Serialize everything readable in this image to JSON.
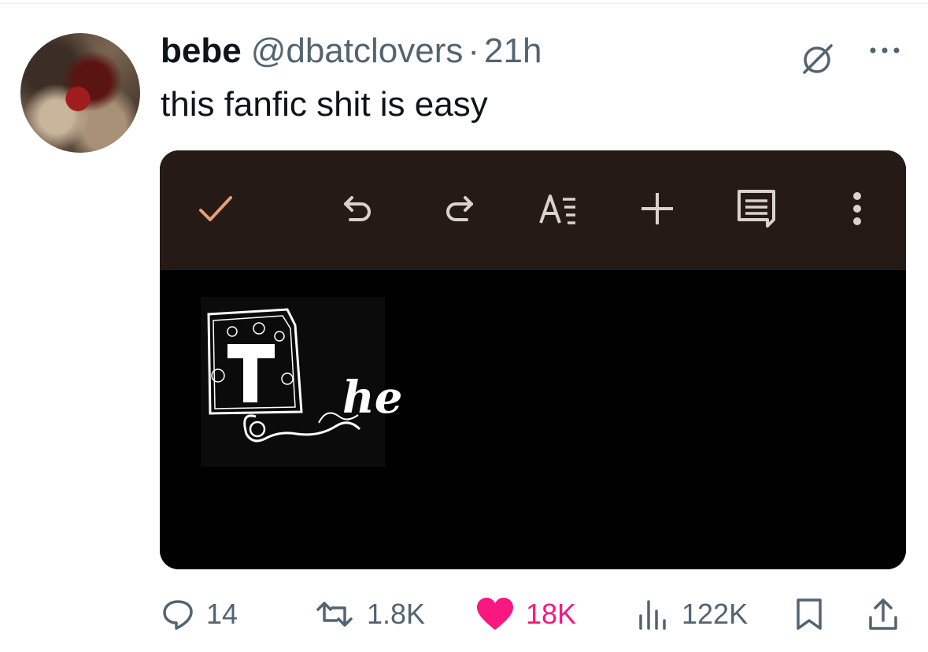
{
  "post": {
    "author_name": "bebe",
    "handle": "@dbatclovers",
    "separator": "·",
    "time": "21h",
    "text": "this fanfic shit is easy"
  },
  "media": {
    "toolbar_icons": [
      "check-icon",
      "undo-icon",
      "redo-icon",
      "text-format-icon",
      "add-icon",
      "comment-icon",
      "more-vert-icon"
    ],
    "image_caption_suffix": "he"
  },
  "actions": {
    "replies": "14",
    "reposts": "1.8K",
    "likes": "18K",
    "views": "122K"
  },
  "colors": {
    "like_pink": "#f91880",
    "secondary_text": "#536471",
    "toolbar_bg": "#261a16",
    "check_orange": "#e8a070"
  }
}
